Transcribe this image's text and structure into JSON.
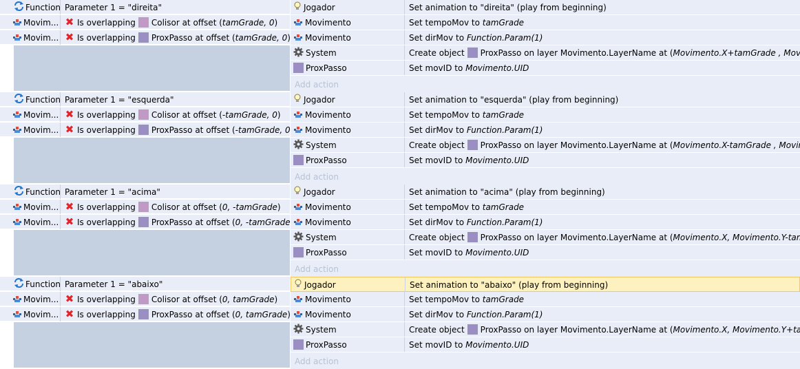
{
  "labels": {
    "function": "Function",
    "movimento_short": "Movim...",
    "is_overlapping": "Is overlapping",
    "add_action": "Add action"
  },
  "icons": [
    "refresh-function-icon",
    "sprite-object-icon",
    "red-x-icon",
    "lightbulb-icon",
    "gear-icon"
  ],
  "colors": {
    "colisor": "#c09ac4",
    "proxpasso": "#9a8ec3",
    "highlight": "#fdf1bf"
  },
  "events": [
    {
      "param": "Parameter 1 = \"direita\"",
      "cond_colisor_pre": "Colisor at offset (",
      "cond_colisor_args": "tamGrade, 0",
      "cond_prox_pre": "ProxPasso at offset (",
      "cond_prox_args": "tamGrade, 0",
      "close": ")",
      "actions": [
        {
          "obj": "Jogador",
          "desc": "Set animation to \"direita\" (play from beginning)"
        },
        {
          "obj": "Movimento",
          "desc": "Set tempoMov to ",
          "val": "tamGrade"
        },
        {
          "obj": "Movimento",
          "desc": "Set dirMov to ",
          "val": "Function.Param(1)"
        },
        {
          "obj": "System",
          "desc": "Create object",
          "obj2": "ProxPasso on layer Movimento.LayerName at (",
          "val": "Movimento.X+tamGrade , Movimento.Y",
          "close": ")"
        },
        {
          "obj": "ProxPasso",
          "desc": "Set movID to ",
          "val": "Movimento.UID"
        }
      ],
      "highlight": false
    },
    {
      "param": "Parameter 1 = \"esquerda\"",
      "cond_colisor_pre": "Colisor at offset (",
      "cond_colisor_args": "-tamGrade, 0",
      "cond_prox_pre": "ProxPasso at offset (",
      "cond_prox_args": "-tamGrade, 0",
      "close": ")",
      "actions": [
        {
          "obj": "Jogador",
          "desc": "Set animation to \"esquerda\" (play from beginning)"
        },
        {
          "obj": "Movimento",
          "desc": "Set tempoMov to ",
          "val": "tamGrade"
        },
        {
          "obj": "Movimento",
          "desc": "Set dirMov to ",
          "val": "Function.Param(1)"
        },
        {
          "obj": "System",
          "desc": "Create object",
          "obj2": "ProxPasso on layer Movimento.LayerName at (",
          "val": "Movimento.X-tamGrade , Movimento.Y",
          "close": ")"
        },
        {
          "obj": "ProxPasso",
          "desc": "Set movID to ",
          "val": "Movimento.UID"
        }
      ],
      "highlight": false
    },
    {
      "param": "Parameter 1 = \"acima\"",
      "cond_colisor_pre": "Colisor at offset (",
      "cond_colisor_args": "0, -tamGrade",
      "cond_prox_pre": "ProxPasso at offset (",
      "cond_prox_args": "0, -tamGrade",
      "close": ")",
      "actions": [
        {
          "obj": "Jogador",
          "desc": "Set animation to \"acima\" (play from beginning)"
        },
        {
          "obj": "Movimento",
          "desc": "Set tempoMov to ",
          "val": "tamGrade"
        },
        {
          "obj": "Movimento",
          "desc": "Set dirMov to ",
          "val": "Function.Param(1)"
        },
        {
          "obj": "System",
          "desc": "Create object",
          "obj2": "ProxPasso on layer Movimento.LayerName at (",
          "val": "Movimento.X, Movimento.Y-tamGrade",
          "close": ")"
        },
        {
          "obj": "ProxPasso",
          "desc": "Set movID to ",
          "val": "Movimento.UID"
        }
      ],
      "highlight": false
    },
    {
      "param": "Parameter 1 = \"abaixo\"",
      "cond_colisor_pre": "Colisor at offset (",
      "cond_colisor_args": "0, tamGrade",
      "cond_prox_pre": "ProxPasso at offset (",
      "cond_prox_args": "0, tamGrade",
      "close": ")",
      "actions": [
        {
          "obj": "Jogador",
          "desc": "Set animation to \"abaixo\" (play from beginning)"
        },
        {
          "obj": "Movimento",
          "desc": "Set tempoMov to ",
          "val": "tamGrade"
        },
        {
          "obj": "Movimento",
          "desc": "Set dirMov to ",
          "val": "Function.Param(1)"
        },
        {
          "obj": "System",
          "desc": "Create object",
          "obj2": "ProxPasso on layer Movimento.LayerName at (",
          "val": "Movimento.X, Movimento.Y+tamGrade",
          "close": ")"
        },
        {
          "obj": "ProxPasso",
          "desc": "Set movID to ",
          "val": "Movimento.UID"
        }
      ],
      "highlight": true
    }
  ]
}
